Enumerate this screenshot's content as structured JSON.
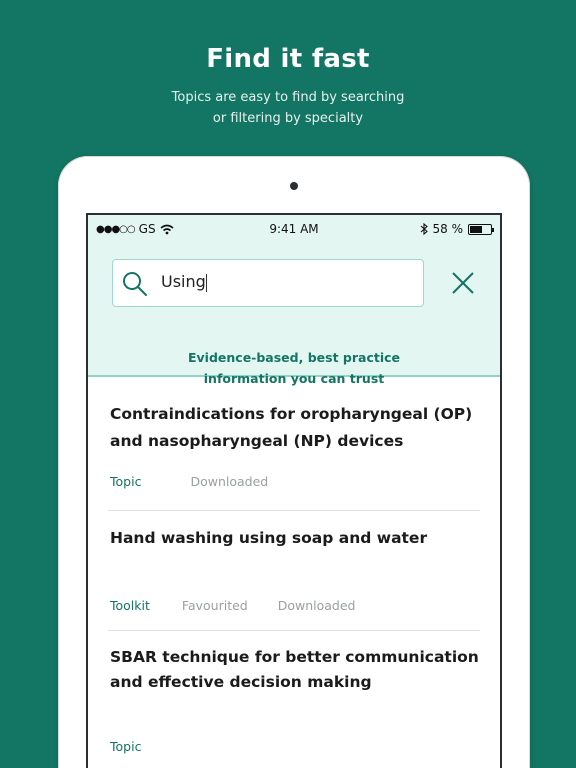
{
  "promo": {
    "headline": "Find it fast",
    "subtitle_line1": "Topics are easy to find by searching",
    "subtitle_line2": "or filtering by specialty"
  },
  "status_bar": {
    "carrier": "GS",
    "signal": "●●●○○",
    "time": "9:41 AM",
    "battery_percent": "58 %",
    "battery_level": 0.58
  },
  "search": {
    "value": "Using",
    "tagline_line1": "Evidence-based, best practice",
    "tagline_line2": "information you can trust"
  },
  "results": [
    {
      "title_line1": "Contraindications for oropharyngeal (OP)",
      "title_line2": "and nasopharyngeal (NP) devices",
      "type": "Topic",
      "flags": [
        "Downloaded"
      ]
    },
    {
      "title_line1": "Hand washing using soap and water",
      "title_line2": "",
      "type": "Toolkit",
      "flags": [
        "Favourited",
        "Downloaded"
      ]
    },
    {
      "title_line1": "SBAR technique for better communication",
      "title_line2": "and effective decision making",
      "type": "Topic",
      "flags": []
    }
  ],
  "colors": {
    "brand_green": "#137563",
    "search_bg": "#e4f6f2",
    "muted": "#9aa0a2"
  }
}
